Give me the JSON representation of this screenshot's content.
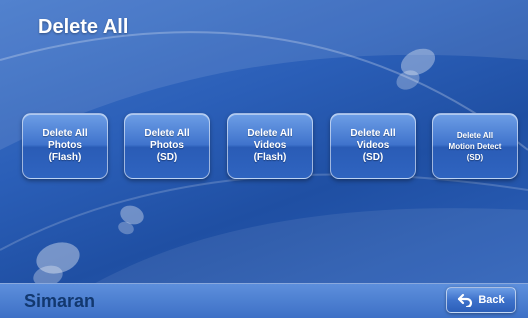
{
  "screen": {
    "title": "Delete All"
  },
  "actions": [
    {
      "label": "Delete All\nPhotos\n(Flash)",
      "icon": null
    },
    {
      "label": "Delete All\nPhotos\n(SD)",
      "icon": null
    },
    {
      "label": "Delete All\nVideos\n(Flash)",
      "icon": null
    },
    {
      "label": "Delete All\nVideos\n(SD)",
      "icon": null
    },
    {
      "label": "Delete All\nMotion Detect\n(SD)",
      "icon": null
    }
  ],
  "footer": {
    "brand": "Simaran",
    "back_label": "Back",
    "back_icon": "return-arrow-icon"
  },
  "colors": {
    "accent": "#2b5fb8",
    "brand_text": "#12386f"
  }
}
